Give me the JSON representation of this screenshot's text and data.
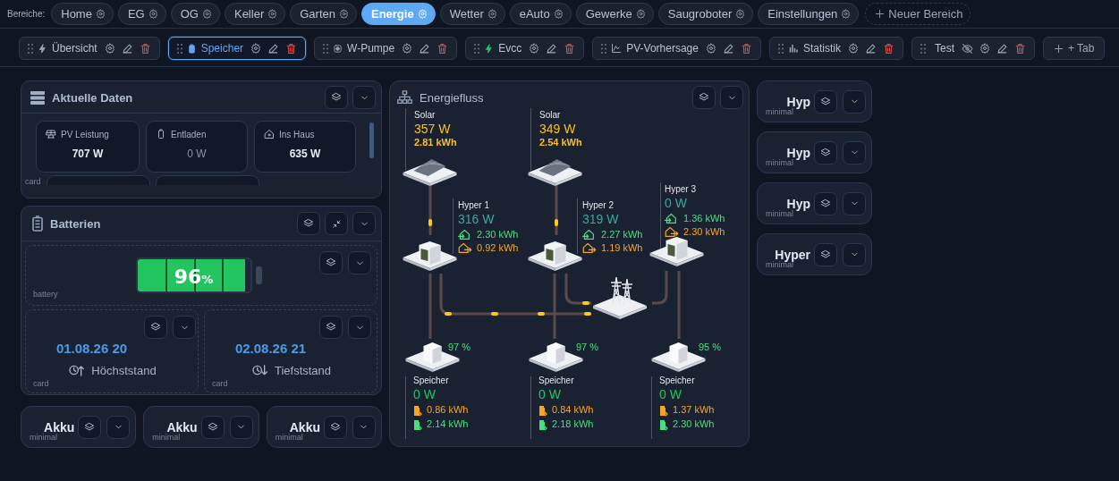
{
  "area_bar": {
    "label": "Bereiche:",
    "areas": [
      {
        "label": "Home",
        "selected": false
      },
      {
        "label": "EG",
        "selected": false
      },
      {
        "label": "OG",
        "selected": false
      },
      {
        "label": "Keller",
        "selected": false
      },
      {
        "label": "Garten",
        "selected": false
      },
      {
        "label": "Energie",
        "selected": true
      },
      {
        "label": "Wetter",
        "selected": false
      },
      {
        "label": "eAuto",
        "selected": false
      },
      {
        "label": "Gewerke",
        "selected": false
      },
      {
        "label": "Saugroboter",
        "selected": false
      },
      {
        "label": "Einstellungen",
        "selected": false
      }
    ],
    "add_button": "Neuer Bereich"
  },
  "tab_bar": {
    "tabs": [
      {
        "label": "Übersicht",
        "selected": false,
        "hidden": false
      },
      {
        "label": "Speicher",
        "selected": true,
        "hidden": false
      },
      {
        "label": "W-Pumpe",
        "selected": false,
        "hidden": false
      },
      {
        "label": "Evcc",
        "selected": false,
        "hidden": false
      },
      {
        "label": "PV-Vorhersage",
        "selected": false,
        "hidden": false
      },
      {
        "label": "Statistik",
        "selected": false,
        "hidden": false
      },
      {
        "label": "Test",
        "selected": false,
        "hidden": true
      }
    ],
    "add_button": "+ Tab"
  },
  "current_data": {
    "title": "Aktuelle Daten",
    "type_label": "card",
    "stats": [
      {
        "label": "PV Leistung",
        "value": "707 W",
        "muted": false
      },
      {
        "label": "Entladen",
        "value": "0 W",
        "muted": true
      },
      {
        "label": "Ins Haus",
        "value": "635 W",
        "muted": false
      }
    ]
  },
  "batteries": {
    "title": "Batterien",
    "battery": {
      "percent": "96",
      "unit": "%",
      "level": 0.96,
      "type_label": "battery"
    },
    "extremes": [
      {
        "date": "01.08.26 20",
        "label": "Höchststand",
        "type_label": "card"
      },
      {
        "date": "02.08.26 21",
        "label": "Tiefststand",
        "type_label": "card"
      }
    ]
  },
  "akku_cards": [
    {
      "title": "Akku",
      "type_label": "minimal"
    },
    {
      "title": "Akku",
      "type_label": "minimal"
    },
    {
      "title": "Akku",
      "type_label": "minimal"
    }
  ],
  "energy_flow": {
    "title": "Energiefluss",
    "solar": [
      {
        "label": "Solar",
        "power": "357 W",
        "energy": "2.81 kWh"
      },
      {
        "label": "Solar",
        "power": "349 W",
        "energy": "2.54 kWh"
      }
    ],
    "inverters": [
      {
        "label": "Hyper 1",
        "power": "316 W",
        "energy_in": "2.30 kWh",
        "energy_out": "0.92 kWh"
      },
      {
        "label": "Hyper 2",
        "power": "319 W",
        "energy_in": "2.27 kWh",
        "energy_out": "1.19 kWh"
      },
      {
        "label": "Hyper 3",
        "power": "0 W",
        "energy_in": "1.36 kWh",
        "energy_out": "2.30 kWh"
      }
    ],
    "storage": [
      {
        "percent": "97 %",
        "label": "Speicher",
        "power": "0 W",
        "charged": "0.86 kWh",
        "discharged": "2.14 kWh"
      },
      {
        "percent": "97 %",
        "label": "Speicher",
        "power": "0 W",
        "charged": "0.84 kWh",
        "discharged": "2.18 kWh"
      },
      {
        "percent": "95 %",
        "label": "Speicher",
        "power": "0 W",
        "charged": "1.37 kWh",
        "discharged": "2.30 kWh"
      }
    ]
  },
  "hyper_cards": [
    {
      "title": "Hyp",
      "type_label": "minimal"
    },
    {
      "title": "Hyp",
      "type_label": "minimal"
    },
    {
      "title": "Hyp",
      "type_label": "minimal"
    },
    {
      "title": "Hyper",
      "type_label": "minimal"
    }
  ]
}
